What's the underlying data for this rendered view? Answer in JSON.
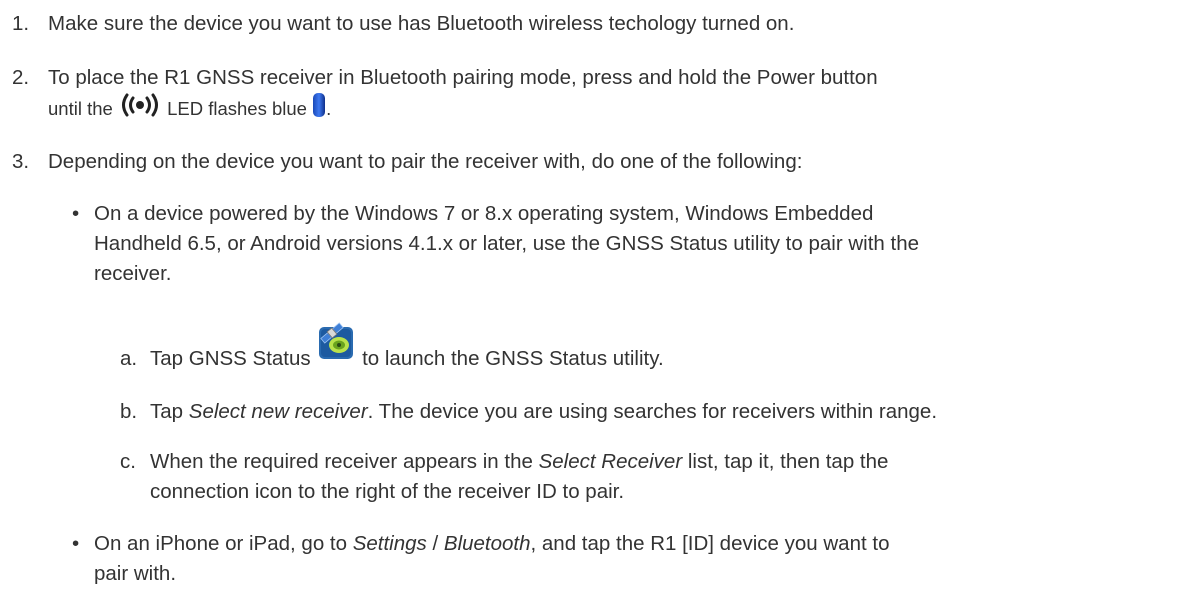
{
  "steps": [
    {
      "num": "1.",
      "text": "Make sure the device you want to use has Bluetooth wireless techology turned on."
    },
    {
      "num": "2.",
      "line1": "To place the R1 GNSS receiver in Bluetooth pairing mode, press and hold the Power button",
      "line2_a": "until the",
      "line2_b": "LED flashes blue",
      "line2_end": "."
    },
    {
      "num": "3.",
      "text": "Depending on the device you want to pair the receiver with, do one of the following:"
    }
  ],
  "bullets": [
    {
      "line1": "On a device powered by the Windows 7 or 8.x operating system, Windows Embedded",
      "line2": "Handheld 6.5, or Android versions 4.1.x or later, use the GNSS Status utility to pair with the",
      "line3": "receiver."
    },
    {
      "a": "On an iPhone or iPad, go to",
      "b": "Settings",
      "c": " / ",
      "d": "Bluetooth",
      "e": ", and tap the R1 [ID] device you want to",
      "line2": "pair with."
    }
  ],
  "substeps": [
    {
      "label": "a.",
      "a": "Tap GNSS Status",
      "b": "to launch the GNSS Status utility."
    },
    {
      "label": "b.",
      "a": "Tap",
      "b": "Select new receiver",
      "c": ". The device you are using searches for receivers within range."
    },
    {
      "label": "c.",
      "a": "When the required receiver appears in the",
      "b": "Select Receiver",
      "c": "list, tap it, then tap the",
      "line2": "connection icon to the right of the receiver ID to pair."
    }
  ],
  "icons": {
    "bluetooth_led": "radio-waves-led-icon",
    "blue_led": "blue-led-icon",
    "gnss_status": "gnss-status-satellite-icon"
  }
}
